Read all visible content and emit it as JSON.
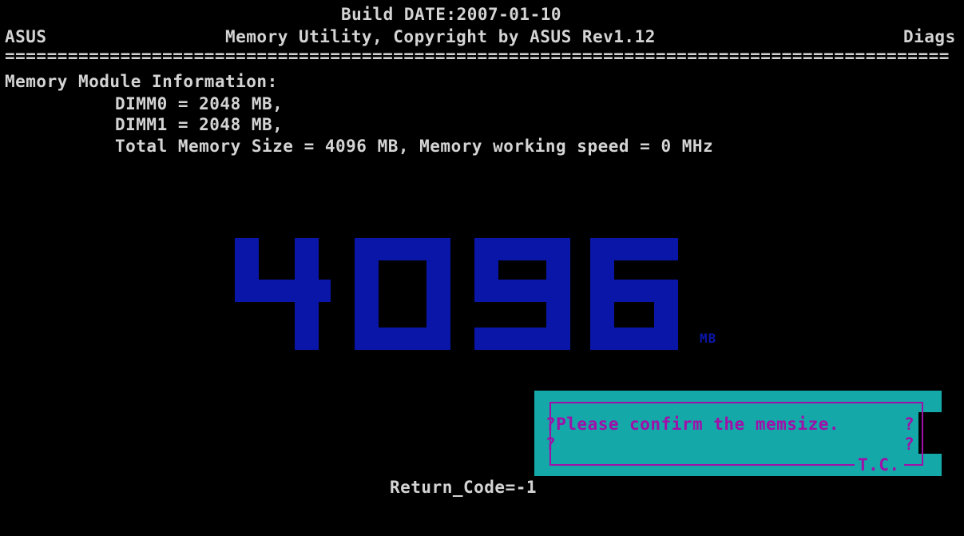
{
  "header": {
    "build_date": "Build DATE:2007-01-10",
    "brand": "ASUS",
    "title": "Memory Utility, Copyright by ASUS Rev1.12",
    "mode": "Diags",
    "separator": "=========================================================================================="
  },
  "memory_info": {
    "heading": "Memory Module Information:",
    "dimm0": "DIMM0 = 2048 MB,",
    "dimm1": "DIMM1 = 2048 MB,",
    "total": "Total Memory Size = 4096 MB, Memory working speed = 0 MHz"
  },
  "big_display": {
    "value": "4096",
    "unit": "MB",
    "color": "#0a16a8"
  },
  "dialog": {
    "message": "?Please confirm the memsize.",
    "right_mark_1": "?",
    "left_mark_2": "?",
    "right_mark_2": "?",
    "footer": "T.C.",
    "background": "#14a8a8",
    "text_color": "#a010a8"
  },
  "return_code": "Return_Code=-1"
}
